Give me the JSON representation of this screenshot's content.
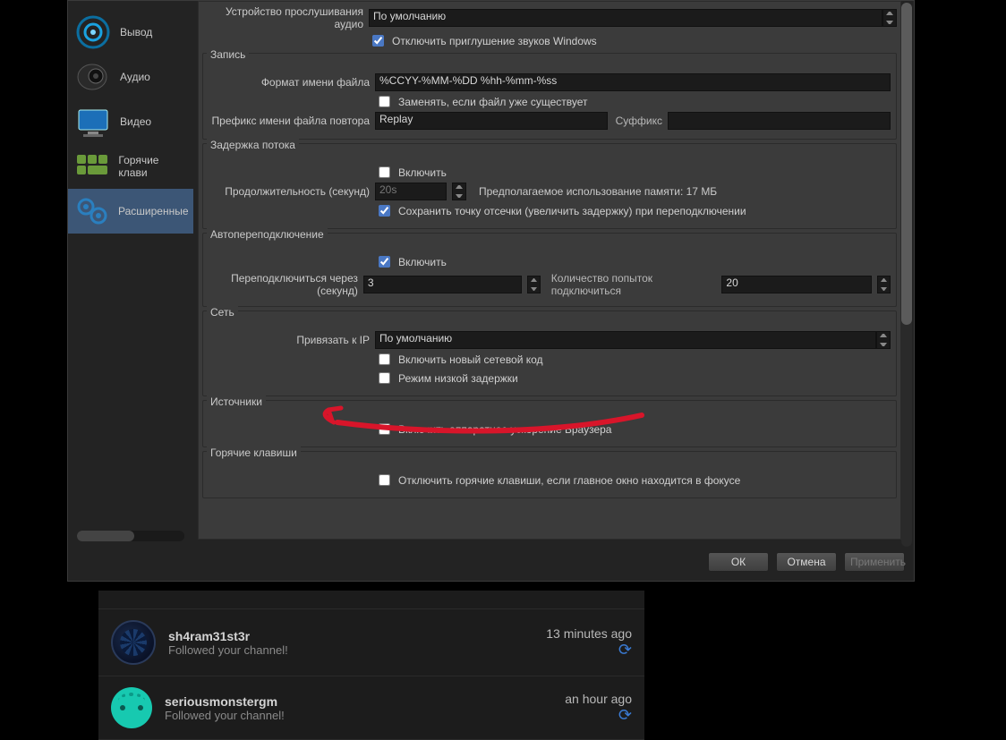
{
  "sidebar": {
    "items": [
      {
        "label": "Вывод"
      },
      {
        "label": "Аудио"
      },
      {
        "label": "Видео"
      },
      {
        "label": "Горячие клави"
      },
      {
        "label": "Расширенные"
      }
    ]
  },
  "sections": {
    "audio_device_label": "Устройство прослушивания аудио",
    "audio_device_value": "По умолчанию",
    "disable_ducking": "Отключить приглушение звуков Windows",
    "recording_title": "Запись",
    "filename_format_label": "Формат имени файла",
    "filename_format_value": "%CCYY-%MM-%DD %hh-%mm-%ss",
    "overwrite_label": "Заменять, если файл уже существует",
    "replay_prefix_label": "Префикс имени файла повтора",
    "replay_prefix_value": "Replay",
    "suffix_label": "Суффикс",
    "suffix_value": "",
    "delay_title": "Задержка потока",
    "enable_label": "Включить",
    "duration_label": "Продолжительность (секунд)",
    "duration_value": "20s",
    "memory_estimate": "Предполагаемое использование памяти: 17 МБ",
    "preserve_cutoff": "Сохранить точку отсечки (увеличить задержку) при переподключении",
    "reconnect_title": "Автопереподключение",
    "retry_delay_label": "Переподключиться через (секунд)",
    "retry_delay_value": "3",
    "max_retries_label": "Количество попыток подключиться",
    "max_retries_value": "20",
    "network_title": "Сеть",
    "bind_ip_label": "Привязать к IP",
    "bind_ip_value": "По умолчанию",
    "new_network_code": "Включить новый сетевой код",
    "low_latency": "Режим низкой задержки",
    "sources_title": "Источники",
    "browser_hw_accel": "Включить аппаратное ускорение Браузера",
    "hotkeys_title": "Горячие клавиши",
    "disable_hotkeys_focus": "Отключить горячие клавиши, если главное окно находится в фокусе"
  },
  "buttons": {
    "ok": "ОК",
    "cancel": "Отмена",
    "apply": "Применить"
  },
  "feed": {
    "items": [
      {
        "name": "sh4ram31st3r",
        "sub": "Followed your channel!",
        "time": "13 minutes ago"
      },
      {
        "name": "seriousmonstergm",
        "sub": "Followed your channel!",
        "time": "an hour ago"
      }
    ]
  }
}
